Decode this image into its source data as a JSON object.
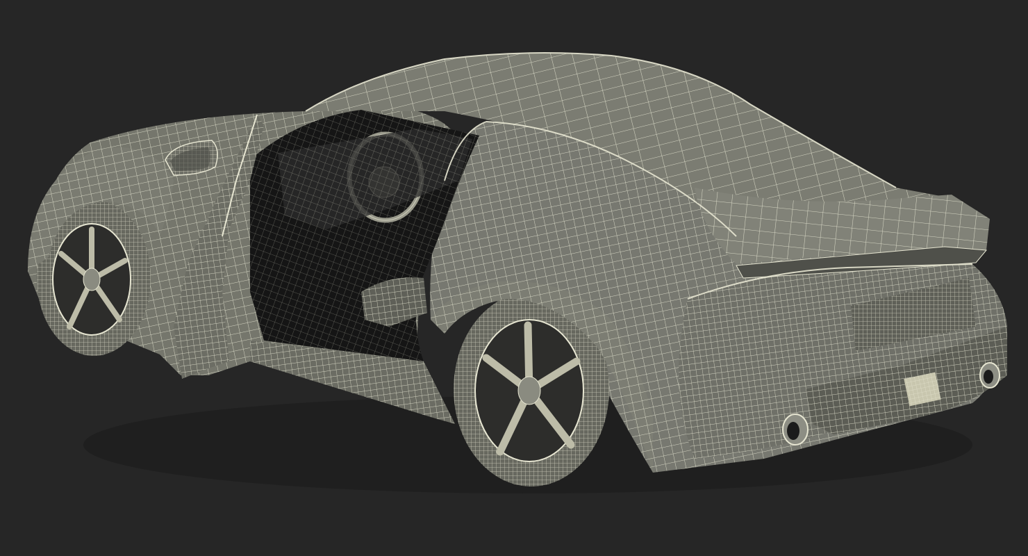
{
  "scene": {
    "subject": "wireframe-sports-car",
    "background_color": "#262626",
    "shell_color": "#75766c",
    "shell_shadow_color": "#55564e",
    "wire_color": "#e7e6d2",
    "interior_color": "#151515",
    "tire_color": "#67685f"
  }
}
